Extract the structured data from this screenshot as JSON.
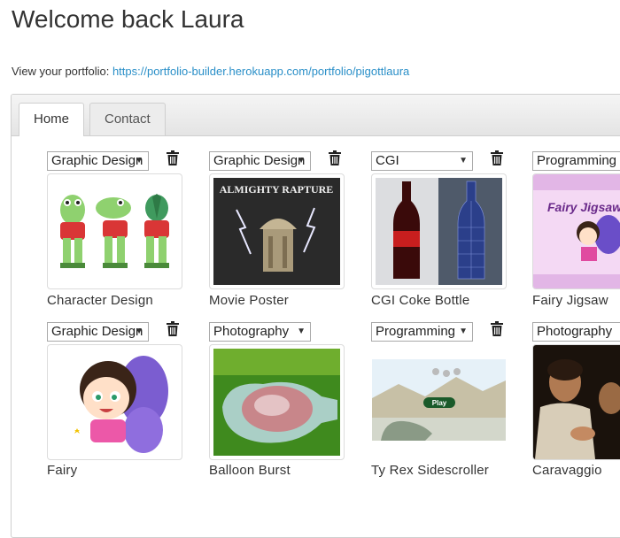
{
  "header": {
    "title": "Welcome back Laura",
    "portfolio_label": "View your portfolio:",
    "portfolio_url": "https://portfolio-builder.herokuapp.com/portfolio/pigottlaura"
  },
  "tabs": [
    {
      "label": "Home",
      "active": true
    },
    {
      "label": "Contact",
      "active": false
    }
  ],
  "items": [
    {
      "category": "Graphic Design",
      "title": "Character Design"
    },
    {
      "category": "Graphic Design",
      "title": "Movie Poster",
      "image_text": "ALMIGHTY RAPTURE"
    },
    {
      "category": "CGI",
      "title": "CGI Coke Bottle"
    },
    {
      "category": "Programming",
      "title": "Fairy Jigsaw",
      "image_text": "Fairy Jigsaw"
    },
    {
      "category": "Graphic Design",
      "title": "Fairy"
    },
    {
      "category": "Photography",
      "title": "Balloon Burst"
    },
    {
      "category": "Programming",
      "title": "Ty Rex Sidescroller",
      "image_text": "Play"
    },
    {
      "category": "Photography",
      "title": "Caravaggio"
    }
  ],
  "colors": {
    "link": "#2a8fc8",
    "text": "#333333"
  }
}
